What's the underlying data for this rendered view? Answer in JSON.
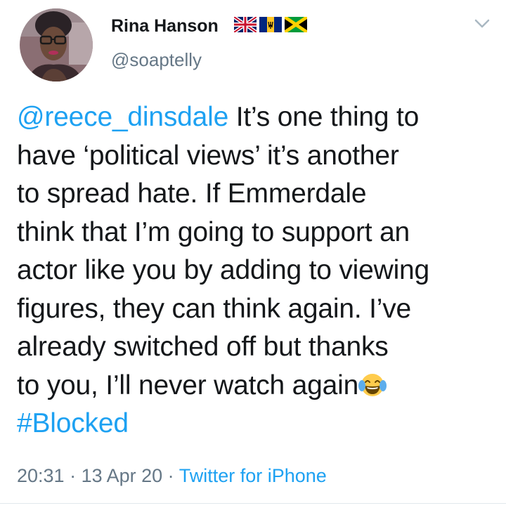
{
  "author": {
    "display_name": "Rina Hanson",
    "handle": "@soaptelly",
    "flag_icons": [
      "uk-flag-icon",
      "barbados-flag-icon",
      "jamaica-flag-icon"
    ]
  },
  "tweet": {
    "mention": "@reece_dinsdale",
    "line_1_rest": " It’s one thing to",
    "line_2": "have ‘political views’ it’s another",
    "line_3": "to spread hate. If Emmerdale",
    "line_4": "think that I’m going to support an",
    "line_5": "actor like you by adding to viewing",
    "line_6": "figures, they can think again. I’ve",
    "line_7": "already switched off but thanks",
    "line_8": "to you, I’ll never watch again",
    "emoji": "face-with-tears-of-joy-icon",
    "hashtag": "#Blocked"
  },
  "meta": {
    "time": "20:31",
    "separator": " · ",
    "date": "13 Apr 20",
    "source": "Twitter for iPhone"
  },
  "colors": {
    "text": "#14171a",
    "secondary": "#657786",
    "link": "#1da1f2",
    "divider": "#e1e8ed"
  },
  "icons": {
    "caret": "chevron-down-icon",
    "avatar": "profile-avatar"
  }
}
